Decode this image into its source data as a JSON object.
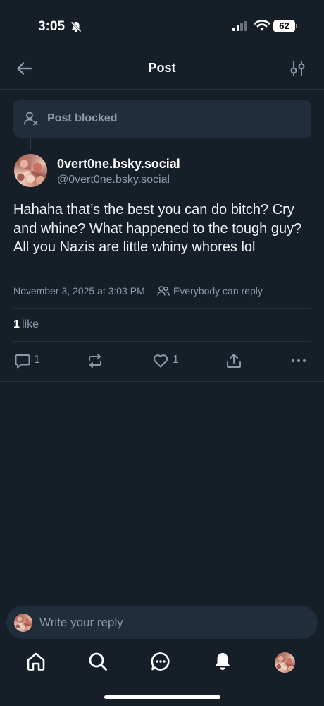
{
  "status_bar": {
    "time": "3:05",
    "battery": "62"
  },
  "header": {
    "title": "Post",
    "back_icon": "arrow-left-icon",
    "filter_icon": "sliders-icon"
  },
  "blocked": {
    "label": "Post blocked",
    "icon": "person-x-icon"
  },
  "post": {
    "display_name": "0vert0ne.bsky.social",
    "handle": "@0vert0ne.bsky.social",
    "text": "Hahaha that’s the best you can do bitch? Cry and whine? What happened to the tough guy? All you Nazis are little whiny whores lol",
    "date": "November 3, 2025 at 3:03 PM",
    "reply_setting": "Everybody can reply",
    "like_count": "1",
    "like_label": "like"
  },
  "actions": {
    "reply_count": "1",
    "like_count": "1"
  },
  "composer": {
    "placeholder": "Write your reply"
  },
  "tabs": [
    "home-icon",
    "search-icon",
    "chat-icon",
    "bell-icon",
    "profile-avatar"
  ],
  "colors": {
    "background": "#161e27",
    "card": "#212d3a",
    "muted_text": "#8c99a8",
    "divider": "#26303b"
  }
}
